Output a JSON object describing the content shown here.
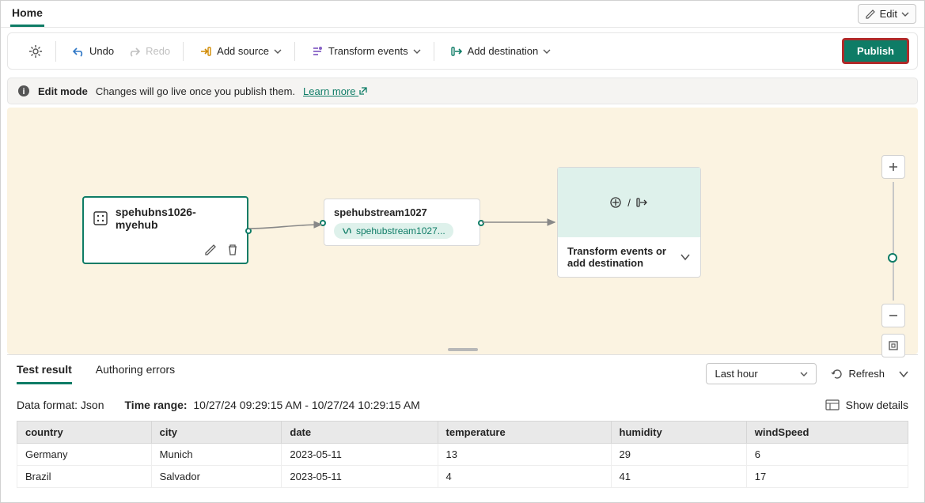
{
  "header": {
    "tab": "Home",
    "edit": "Edit"
  },
  "toolbar": {
    "undo": "Undo",
    "redo": "Redo",
    "add_source": "Add source",
    "transform": "Transform events",
    "add_dest": "Add destination",
    "publish": "Publish"
  },
  "info": {
    "mode": "Edit mode",
    "msg": "Changes will go live once you publish them.",
    "learn": "Learn more"
  },
  "nodes": {
    "source": {
      "title": "spehubns1026-myehub"
    },
    "stream": {
      "title": "spehubstream1027",
      "pill": "spehubstream1027..."
    },
    "dest": {
      "title": "Transform events or add destination"
    }
  },
  "bottom": {
    "tabs": {
      "result": "Test result",
      "errors": "Authoring errors"
    },
    "range_select": "Last hour",
    "refresh": "Refresh",
    "data_format_label": "Data format:",
    "data_format": "Json",
    "time_label": "Time range:",
    "time_value": "10/27/24 09:29:15 AM - 10/27/24 10:29:15 AM",
    "show_details": "Show details",
    "columns": [
      "country",
      "city",
      "date",
      "temperature",
      "humidity",
      "windSpeed"
    ],
    "rows": [
      {
        "country": "Germany",
        "city": "Munich",
        "date": "2023-05-11",
        "temperature": "13",
        "humidity": "29",
        "windSpeed": "6"
      },
      {
        "country": "Brazil",
        "city": "Salvador",
        "date": "2023-05-11",
        "temperature": "4",
        "humidity": "41",
        "windSpeed": "17"
      }
    ]
  }
}
